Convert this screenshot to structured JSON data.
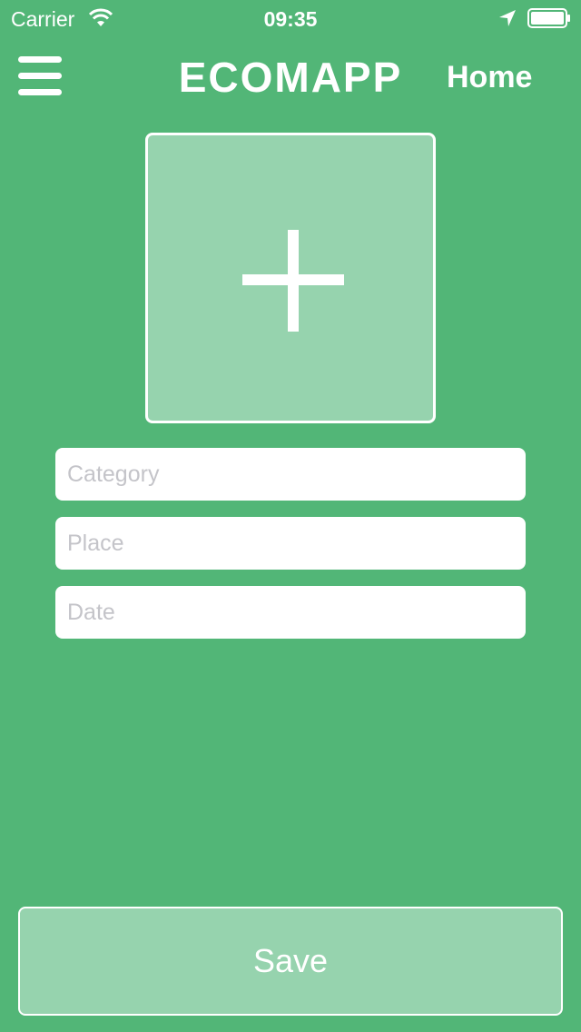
{
  "status_bar": {
    "carrier": "Carrier",
    "time": "09:35",
    "wifi_icon": "wifi-icon",
    "location_icon": "location-arrow-icon",
    "battery_icon": "battery-icon"
  },
  "nav": {
    "menu_icon": "hamburger-menu-icon",
    "title": "ECOMAPP",
    "home_label": "Home"
  },
  "photo_box": {
    "icon": "plus-icon"
  },
  "form": {
    "category_placeholder": "Category",
    "place_placeholder": "Place",
    "date_placeholder": "Date",
    "category_value": "",
    "place_value": "",
    "date_value": ""
  },
  "save_label": "Save",
  "colors": {
    "background": "#52b677",
    "accent_light": "#96d3ae",
    "text": "#ffffff"
  }
}
